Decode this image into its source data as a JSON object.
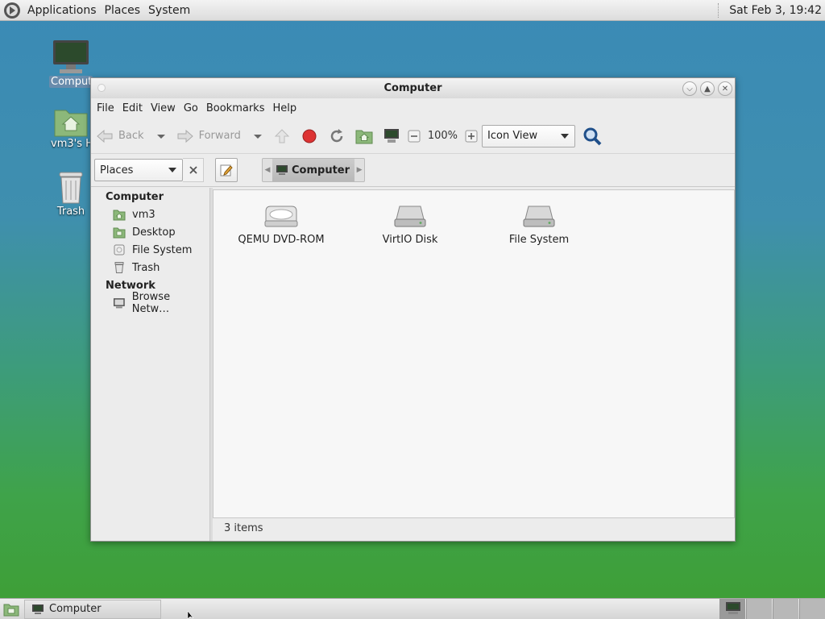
{
  "topbar": {
    "menus": [
      "Applications",
      "Places",
      "System"
    ],
    "clock": "Sat Feb  3, 19:42"
  },
  "desktop": {
    "icons": [
      {
        "label": "Computer"
      },
      {
        "label": "vm3's Home"
      },
      {
        "label": "Trash"
      }
    ]
  },
  "window": {
    "title": "Computer",
    "menubar": [
      "File",
      "Edit",
      "View",
      "Go",
      "Bookmarks",
      "Help"
    ],
    "toolbar": {
      "back": "Back",
      "forward": "Forward",
      "zoom": "100%",
      "view_mode": "Icon View"
    },
    "location": {
      "places_label": "Places",
      "crumb": "Computer"
    },
    "sidebar": {
      "sections": [
        {
          "header": "Computer",
          "items": [
            "vm3",
            "Desktop",
            "File System",
            "Trash"
          ]
        },
        {
          "header": "Network",
          "items": [
            "Browse Netw…"
          ]
        }
      ]
    },
    "files": [
      {
        "name": "QEMU DVD-ROM"
      },
      {
        "name": "VirtIO Disk"
      },
      {
        "name": "File System"
      }
    ],
    "status": "3 items"
  },
  "taskbar": {
    "task": "Computer"
  }
}
